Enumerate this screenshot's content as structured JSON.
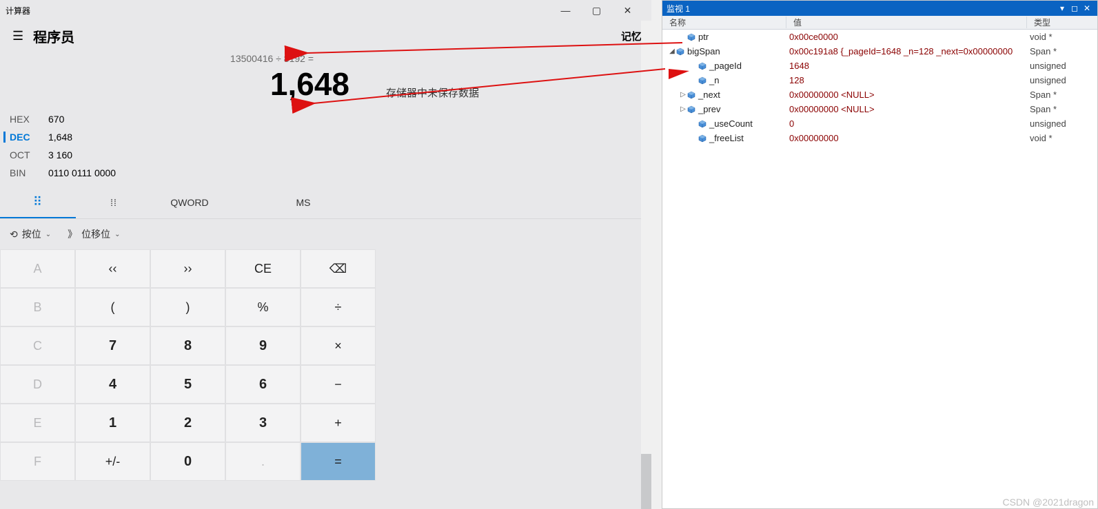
{
  "calc": {
    "title": "计算器",
    "mode": "程序员",
    "memory_title": "记忆",
    "expression": "13500416 ÷ 8192 =",
    "result": "1,648",
    "memory_empty": "存储器中未保存数据",
    "bases": [
      {
        "label": "HEX",
        "value": "670",
        "active": false
      },
      {
        "label": "DEC",
        "value": "1,648",
        "active": true
      },
      {
        "label": "OCT",
        "value": "3 160",
        "active": false
      },
      {
        "label": "BIN",
        "value": "0110 0111 0000",
        "active": false
      }
    ],
    "modebar": {
      "qword": "QWORD",
      "ms": "MS"
    },
    "bitops": {
      "bitwise": "按位",
      "shift": "位移位"
    },
    "keys": [
      [
        "A",
        "‹‹",
        "››",
        "CE",
        "⌫"
      ],
      [
        "B",
        "(",
        ")",
        "%",
        "÷"
      ],
      [
        "C",
        "7",
        "8",
        "9",
        "×"
      ],
      [
        "D",
        "4",
        "5",
        "6",
        "−"
      ],
      [
        "E",
        "1",
        "2",
        "3",
        "+"
      ],
      [
        "F",
        "+/-",
        "0",
        ".",
        "="
      ]
    ],
    "disabled_keys": [
      "A",
      "B",
      "C",
      "D",
      "E",
      "F",
      "."
    ]
  },
  "watch": {
    "title": "监视 1",
    "columns": {
      "name": "名称",
      "value": "值",
      "type": "类型"
    },
    "rows": [
      {
        "depth": 1,
        "exp": "",
        "name": "ptr",
        "value": "0x00ce0000",
        "type": "void *"
      },
      {
        "depth": 0,
        "exp": "▉",
        "open": true,
        "name": "bigSpan",
        "value": "0x00c191a8 {_pageId=1648 _n=128 _next=0x00000000",
        "type": "Span *"
      },
      {
        "depth": 2,
        "exp": "",
        "name": "_pageId",
        "value": "1648",
        "type": "unsigned"
      },
      {
        "depth": 2,
        "exp": "",
        "name": "_n",
        "value": "128",
        "type": "unsigned"
      },
      {
        "depth": 1,
        "exp": "▷",
        "name": "_next",
        "value": "0x00000000 <NULL>",
        "type": "Span *"
      },
      {
        "depth": 1,
        "exp": "▷",
        "name": "_prev",
        "value": "0x00000000 <NULL>",
        "type": "Span *"
      },
      {
        "depth": 2,
        "exp": "",
        "name": "_useCount",
        "value": "0",
        "type": "unsigned"
      },
      {
        "depth": 2,
        "exp": "",
        "name": "_freeList",
        "value": "0x00000000",
        "type": "void *"
      }
    ]
  },
  "watermark": "CSDN @2021dragon"
}
